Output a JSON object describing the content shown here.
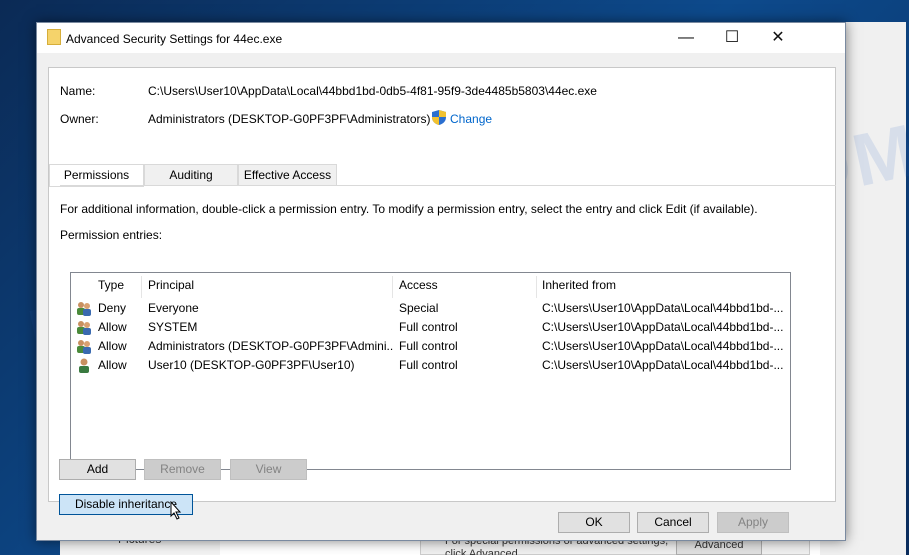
{
  "window": {
    "title": "Advanced Security Settings for 44ec.exe",
    "minimize": "—",
    "maximize": "☐",
    "close": "✕"
  },
  "name_label": "Name:",
  "name_value": "C:\\Users\\User10\\AppData\\Local\\44bbd1bd-0db5-4f81-95f9-3de4485b5803\\44ec.exe",
  "owner_label": "Owner:",
  "owner_value": "Administrators (DESKTOP-G0PF3PF\\Administrators)",
  "change_link": "Change",
  "tabs": [
    "Permissions",
    "Auditing",
    "Effective Access"
  ],
  "info_text": "For additional information, double-click a permission entry. To modify a permission entry, select the entry and click Edit (if available).",
  "entries_label": "Permission entries:",
  "columns": [
    "Type",
    "Principal",
    "Access",
    "Inherited from"
  ],
  "rows": [
    {
      "type": "Deny",
      "principal": "Everyone",
      "access": "Special",
      "inherited": "C:\\Users\\User10\\AppData\\Local\\44bbd1bd-...",
      "icon": "group"
    },
    {
      "type": "Allow",
      "principal": "SYSTEM",
      "access": "Full control",
      "inherited": "C:\\Users\\User10\\AppData\\Local\\44bbd1bd-...",
      "icon": "group"
    },
    {
      "type": "Allow",
      "principal": "Administrators (DESKTOP-G0PF3PF\\Admini...",
      "access": "Full control",
      "inherited": "C:\\Users\\User10\\AppData\\Local\\44bbd1bd-...",
      "icon": "group"
    },
    {
      "type": "Allow",
      "principal": "User10 (DESKTOP-G0PF3PF\\User10)",
      "access": "Full control",
      "inherited": "C:\\Users\\User10\\AppData\\Local\\44bbd1bd-...",
      "icon": "user"
    }
  ],
  "buttons": {
    "add": "Add",
    "remove": "Remove",
    "view": "View",
    "disable_inheritance": "Disable inheritance",
    "ok": "OK",
    "cancel": "Cancel",
    "apply": "Apply"
  },
  "background": {
    "pictures": "Pictures",
    "advanced_text": "For special permissions or advanced settings, click Advanced.",
    "advanced_button": "Advanced"
  },
  "watermark": "MYANTISPYWARE.COM"
}
